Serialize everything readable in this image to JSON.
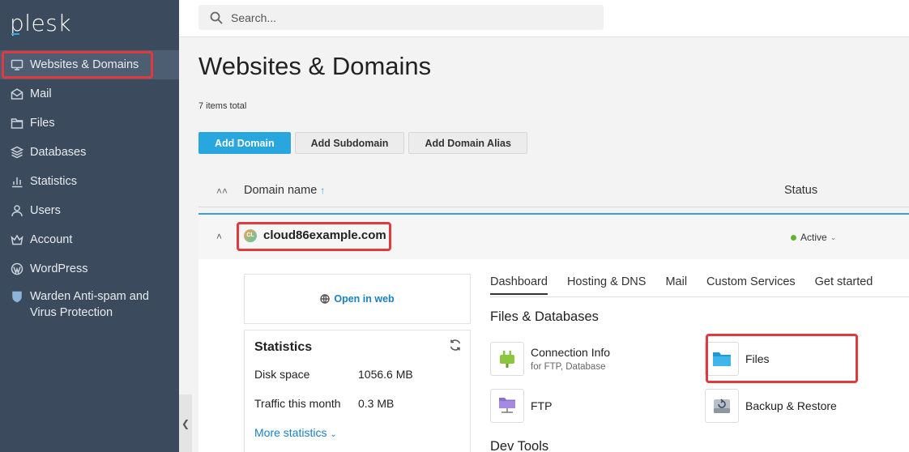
{
  "app": {
    "logo": "plesk"
  },
  "search": {
    "placeholder": "Search..."
  },
  "sidebar": {
    "items": [
      {
        "label": "Websites & Domains",
        "icon": "monitor-icon"
      },
      {
        "label": "Mail",
        "icon": "mail-icon"
      },
      {
        "label": "Files",
        "icon": "folder-icon"
      },
      {
        "label": "Databases",
        "icon": "database-icon"
      },
      {
        "label": "Statistics",
        "icon": "bar-chart-icon"
      },
      {
        "label": "Users",
        "icon": "user-icon"
      },
      {
        "label": "Account",
        "icon": "crown-icon"
      },
      {
        "label": "WordPress",
        "icon": "wordpress-icon"
      },
      {
        "label": "Warden Anti-spam and Virus Protection",
        "icon": "shield-icon"
      }
    ]
  },
  "page": {
    "title": "Websites & Domains",
    "items_total": "7 items total",
    "buttons": {
      "add_domain": "Add Domain",
      "add_subdomain": "Add Subdomain",
      "add_alias": "Add Domain Alias"
    },
    "columns": {
      "domain": "Domain name",
      "status": "Status"
    }
  },
  "domain": {
    "name": "cloud86example.com",
    "favicon_text": "CL",
    "status": "Active",
    "open_in_web": "Open in web",
    "stats": {
      "title": "Statistics",
      "disk_label": "Disk space",
      "disk_value": "1056.6 MB",
      "traffic_label": "Traffic this month",
      "traffic_value": "0.3 MB",
      "more": "More statistics"
    },
    "tabs": [
      "Dashboard",
      "Hosting & DNS",
      "Mail",
      "Custom Services",
      "Get started"
    ],
    "section_files": "Files & Databases",
    "tools": {
      "connection": {
        "name": "Connection Info",
        "sub": "for FTP, Database"
      },
      "files": {
        "name": "Files"
      },
      "ftp": {
        "name": "FTP"
      },
      "backup": {
        "name": "Backup & Restore"
      }
    },
    "section_dev": "Dev Tools"
  },
  "colors": {
    "sidebar": "#3b4a5c",
    "primary": "#28a6de",
    "highlight": "#e0393e",
    "active_status": "#63b32e"
  }
}
